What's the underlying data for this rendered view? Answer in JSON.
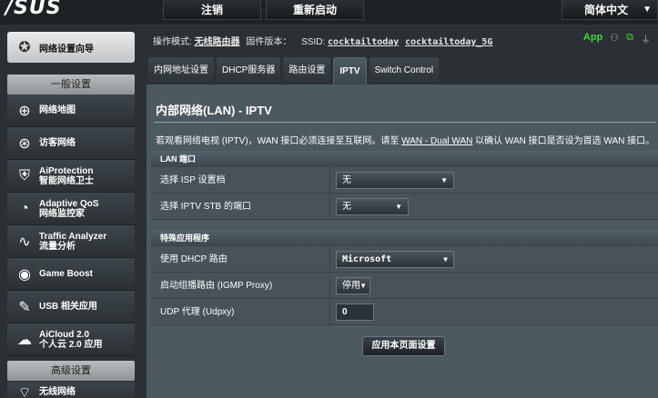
{
  "topbar": {
    "logo": "/SUS",
    "logout_label": "注销",
    "reboot_label": "重新启动",
    "language_label": "简体中文"
  },
  "sidebar": {
    "quick_setup": "网络设置向导",
    "general_header": "一般设置",
    "items": [
      {
        "label": "网络地图",
        "icon": "globe-icon"
      },
      {
        "label": "访客网络",
        "icon": "guest-network-icon"
      },
      {
        "label": "AiProtection",
        "sub": "智能网络卫士",
        "icon": "shield-icon"
      },
      {
        "label": "Adaptive QoS",
        "sub": "网络监控家",
        "icon": "gauge-icon"
      },
      {
        "label": "Traffic Analyzer",
        "sub": "流量分析",
        "icon": "pulse-icon"
      },
      {
        "label": "Game Boost",
        "icon": "gamepad-icon"
      },
      {
        "label": "USB 相关应用",
        "icon": "usb-icon"
      },
      {
        "label": "AiCloud 2.0",
        "sub": "个人云 2.0 应用",
        "icon": "cloud-icon"
      }
    ],
    "advanced_header": "高级设置",
    "wireless": "无线网络"
  },
  "status": {
    "mode_label": "操作模式:",
    "mode_value": "无线路由器",
    "fw_label": "固件版本：",
    "ssid_label": "SSID:",
    "ssid_1": "cocktailtoday",
    "ssid_2": "cocktailtoday_5G",
    "app_label": "App"
  },
  "tabs": [
    "内网地址设置",
    "DHCP服务器",
    "路由设置",
    "IPTV",
    "Switch Control"
  ],
  "page": {
    "title": "内部网络(LAN) - IPTV",
    "desc_pre": "若观看网络电视 (IPTV)，WAN 接口必须连接至互联网。请至",
    "desc_link": "WAN - Dual WAN",
    "desc_post": "以确认 WAN 接口是否设为首选 WAN 接口。"
  },
  "lan_port": {
    "header": "LAN 端口",
    "isp_label": "选择 ISP 设置档",
    "isp_value": "无",
    "stb_label": "选择 IPTV STB 的端口",
    "stb_value": "无"
  },
  "special": {
    "header": "特殊应用程序",
    "dhcp_label": "使用 DHCP 路由",
    "dhcp_value": "Microsoft",
    "igmp_label": "启动组播路由 (IGMP Proxy)",
    "igmp_value": "停用",
    "udpxy_label": "UDP 代理 (Udpxy)",
    "udpxy_value": "0"
  },
  "apply_label": "应用本页面设置"
}
